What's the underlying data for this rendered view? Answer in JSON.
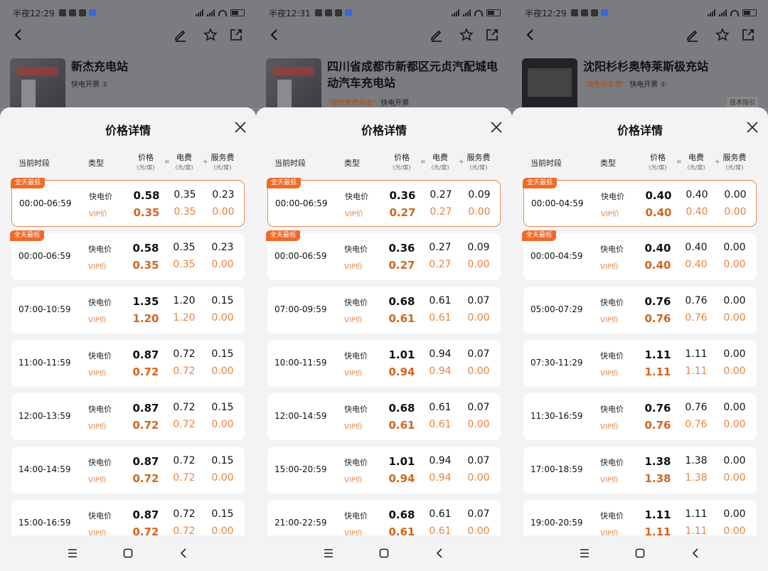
{
  "colors": {
    "accent": "#f06a28",
    "vip": "#e9833f",
    "overlay": "#7b7c80"
  },
  "icons": [
    "back-icon",
    "edit-icon",
    "star-icon",
    "share-icon",
    "close-icon",
    "menu-icon",
    "home-icon",
    "nav-back-icon"
  ],
  "screens": [
    {
      "time": "半夜12:29",
      "station": {
        "name": "新杰充电站",
        "tag": "",
        "open": "快电开票 ①",
        "link": ""
      },
      "sheet": {
        "title": "价格详情",
        "headers": {
          "period": "当前时段",
          "type": "类型",
          "price": "价格",
          "elec": "电费",
          "service": "服务费",
          "unit": "(元/度)",
          "op_eq": "=",
          "op_plus": "+"
        },
        "rows": [
          {
            "badge": "全天最低",
            "highlight": true,
            "period": "00:00-06:59",
            "type_fast": "快电价",
            "type_vip": "VIP价",
            "fast": [
              "0.58",
              "0.35",
              "0.23"
            ],
            "vip": [
              "0.35",
              "0.35",
              "0.00"
            ]
          },
          {
            "badge": "全天最低",
            "highlight": false,
            "period": "00:00-06:59",
            "type_fast": "快电价",
            "type_vip": "VIP价",
            "fast": [
              "0.58",
              "0.35",
              "0.23"
            ],
            "vip": [
              "0.35",
              "0.35",
              "0.00"
            ]
          },
          {
            "badge": "",
            "highlight": false,
            "period": "07:00-10:59",
            "type_fast": "快电价",
            "type_vip": "VIP价",
            "fast": [
              "1.35",
              "1.20",
              "0.15"
            ],
            "vip": [
              "1.20",
              "1.20",
              "0.00"
            ]
          },
          {
            "badge": "",
            "highlight": false,
            "period": "11:00-11:59",
            "type_fast": "快电价",
            "type_vip": "VIP价",
            "fast": [
              "0.87",
              "0.72",
              "0.15"
            ],
            "vip": [
              "0.72",
              "0.72",
              "0.00"
            ]
          },
          {
            "badge": "",
            "highlight": false,
            "period": "12:00-13:59",
            "type_fast": "快电价",
            "type_vip": "VIP价",
            "fast": [
              "0.87",
              "0.72",
              "0.15"
            ],
            "vip": [
              "0.72",
              "0.72",
              "0.00"
            ]
          },
          {
            "badge": "",
            "highlight": false,
            "period": "14:00-14:59",
            "type_fast": "快电价",
            "type_vip": "VIP价",
            "fast": [
              "0.87",
              "0.72",
              "0.15"
            ],
            "vip": [
              "0.72",
              "0.72",
              "0.00"
            ]
          },
          {
            "badge": "",
            "highlight": false,
            "period": "15:00-16:59",
            "type_fast": "快电价",
            "type_vip": "VIP价",
            "fast": [
              "0.87",
              "0.72",
              "0.15"
            ],
            "vip": [
              "0.72",
              "0.72",
              "0.00"
            ]
          }
        ]
      }
    },
    {
      "time": "半夜12:31",
      "station": {
        "name": "四川省成都市新都区元贞汽配城电动汽车充电站",
        "tag": "\"限时免费停车\"",
        "open": "快电开票",
        "link": ""
      },
      "sheet": {
        "title": "价格详情",
        "headers": {
          "period": "当前时段",
          "type": "类型",
          "price": "价格",
          "elec": "电费",
          "service": "服务费",
          "unit": "(元/度)",
          "op_eq": "=",
          "op_plus": "+"
        },
        "rows": [
          {
            "badge": "全天最低",
            "highlight": true,
            "period": "00:00-06:59",
            "type_fast": "快电价",
            "type_vip": "VIP价",
            "fast": [
              "0.36",
              "0.27",
              "0.09"
            ],
            "vip": [
              "0.27",
              "0.27",
              "0.00"
            ]
          },
          {
            "badge": "全天最低",
            "highlight": false,
            "period": "00:00-06:59",
            "type_fast": "快电价",
            "type_vip": "VIP价",
            "fast": [
              "0.36",
              "0.27",
              "0.09"
            ],
            "vip": [
              "0.27",
              "0.27",
              "0.00"
            ]
          },
          {
            "badge": "",
            "highlight": false,
            "period": "07:00-09:59",
            "type_fast": "快电价",
            "type_vip": "VIP价",
            "fast": [
              "0.68",
              "0.61",
              "0.07"
            ],
            "vip": [
              "0.61",
              "0.61",
              "0.00"
            ]
          },
          {
            "badge": "",
            "highlight": false,
            "period": "10:00-11:59",
            "type_fast": "快电价",
            "type_vip": "VIP价",
            "fast": [
              "1.01",
              "0.94",
              "0.07"
            ],
            "vip": [
              "0.94",
              "0.94",
              "0.00"
            ]
          },
          {
            "badge": "",
            "highlight": false,
            "period": "12:00-14:59",
            "type_fast": "快电价",
            "type_vip": "VIP价",
            "fast": [
              "0.68",
              "0.61",
              "0.07"
            ],
            "vip": [
              "0.61",
              "0.61",
              "0.00"
            ]
          },
          {
            "badge": "",
            "highlight": false,
            "period": "15:00-20:59",
            "type_fast": "快电价",
            "type_vip": "VIP价",
            "fast": [
              "1.01",
              "0.94",
              "0.07"
            ],
            "vip": [
              "0.94",
              "0.94",
              "0.00"
            ]
          },
          {
            "badge": "",
            "highlight": false,
            "period": "21:00-22:59",
            "type_fast": "快电价",
            "type_vip": "VIP价",
            "fast": [
              "0.68",
              "0.61",
              "0.07"
            ],
            "vip": [
              "0.61",
              "0.61",
              "0.00"
            ]
          }
        ]
      }
    },
    {
      "time": "半夜12:29",
      "station": {
        "name": "沈阳杉杉奥特莱斯极充站",
        "tag": "\"减免停车费\"",
        "open": "快电开票 ①",
        "link": "技术指引"
      },
      "sheet": {
        "title": "价格详情",
        "headers": {
          "period": "当前时段",
          "type": "类型",
          "price": "价格",
          "elec": "电费",
          "service": "服务费",
          "unit": "(元/度)",
          "op_eq": "=",
          "op_plus": "+"
        },
        "rows": [
          {
            "badge": "全天最低",
            "highlight": true,
            "period": "00:00-04:59",
            "type_fast": "快电价",
            "type_vip": "VIP价",
            "fast": [
              "0.40",
              "0.40",
              "0.00"
            ],
            "vip": [
              "0.40",
              "0.40",
              "0.00"
            ]
          },
          {
            "badge": "全天最低",
            "highlight": false,
            "period": "00:00-04:59",
            "type_fast": "快电价",
            "type_vip": "VIP价",
            "fast": [
              "0.40",
              "0.40",
              "0.00"
            ],
            "vip": [
              "0.40",
              "0.40",
              "0.00"
            ]
          },
          {
            "badge": "",
            "highlight": false,
            "period": "05:00-07:29",
            "type_fast": "快电价",
            "type_vip": "VIP价",
            "fast": [
              "0.76",
              "0.76",
              "0.00"
            ],
            "vip": [
              "0.76",
              "0.76",
              "0.00"
            ]
          },
          {
            "badge": "",
            "highlight": false,
            "period": "07:30-11:29",
            "type_fast": "快电价",
            "type_vip": "VIP价",
            "fast": [
              "1.11",
              "1.11",
              "0.00"
            ],
            "vip": [
              "1.11",
              "1.11",
              "0.00"
            ]
          },
          {
            "badge": "",
            "highlight": false,
            "period": "11:30-16:59",
            "type_fast": "快电价",
            "type_vip": "VIP价",
            "fast": [
              "0.76",
              "0.76",
              "0.00"
            ],
            "vip": [
              "0.76",
              "0.76",
              "0.00"
            ]
          },
          {
            "badge": "",
            "highlight": false,
            "period": "17:00-18:59",
            "type_fast": "快电价",
            "type_vip": "VIP价",
            "fast": [
              "1.38",
              "1.38",
              "0.00"
            ],
            "vip": [
              "1.38",
              "1.38",
              "0.00"
            ]
          },
          {
            "badge": "",
            "highlight": false,
            "period": "19:00-20:59",
            "type_fast": "快电价",
            "type_vip": "VIP价",
            "fast": [
              "1.11",
              "1.11",
              "0.00"
            ],
            "vip": [
              "1.11",
              "1.11",
              "0.00"
            ]
          }
        ]
      }
    }
  ]
}
